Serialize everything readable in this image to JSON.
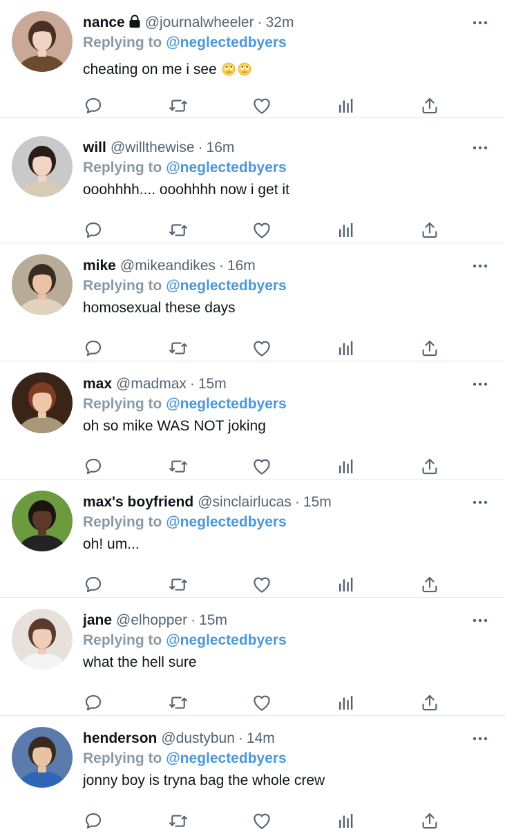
{
  "reply_prefix": "Replying to",
  "tweets": [
    {
      "name": "nance",
      "handle": "@journalwheeler",
      "time": "32m",
      "replying_to": "@neglectedbyers",
      "text": "cheating on me i see",
      "locked": true,
      "emoji": [
        "eye-roll-emoji",
        "eye-roll-emoji"
      ]
    },
    {
      "name": "will",
      "handle": "@willthewise",
      "time": "16m",
      "replying_to": "@neglectedbyers",
      "text": "ooohhhh.... ooohhhh now i get it"
    },
    {
      "name": "mike",
      "handle": "@mikeandikes",
      "time": "16m",
      "replying_to": "@neglectedbyers",
      "text": "homosexual these days"
    },
    {
      "name": "max",
      "handle": "@madmax",
      "time": "15m",
      "replying_to": "@neglectedbyers",
      "text": "oh so mike WAS NOT joking"
    },
    {
      "name": "max's boyfriend",
      "handle": "@sinclairlucas",
      "time": "15m",
      "replying_to": "@neglectedbyers",
      "text": "oh! um..."
    },
    {
      "name": "jane",
      "handle": "@elhopper",
      "time": "15m",
      "replying_to": "@neglectedbyers",
      "text": "what the hell sure"
    },
    {
      "name": "henderson",
      "handle": "@dustybun",
      "time": "14m",
      "replying_to": "@neglectedbyers",
      "text": "jonny boy is tryna bag the whole crew"
    }
  ],
  "icons": {
    "reply": "reply-icon",
    "retweet": "retweet-icon",
    "like": "like-icon",
    "views": "analytics-icon",
    "share": "share-icon",
    "more": "more-icon",
    "lock": "lock-icon"
  },
  "colors": {
    "mention": "#4a98d8",
    "muted": "#536471",
    "reply_label": "#8899a6",
    "divider": "#e3e6e8"
  }
}
